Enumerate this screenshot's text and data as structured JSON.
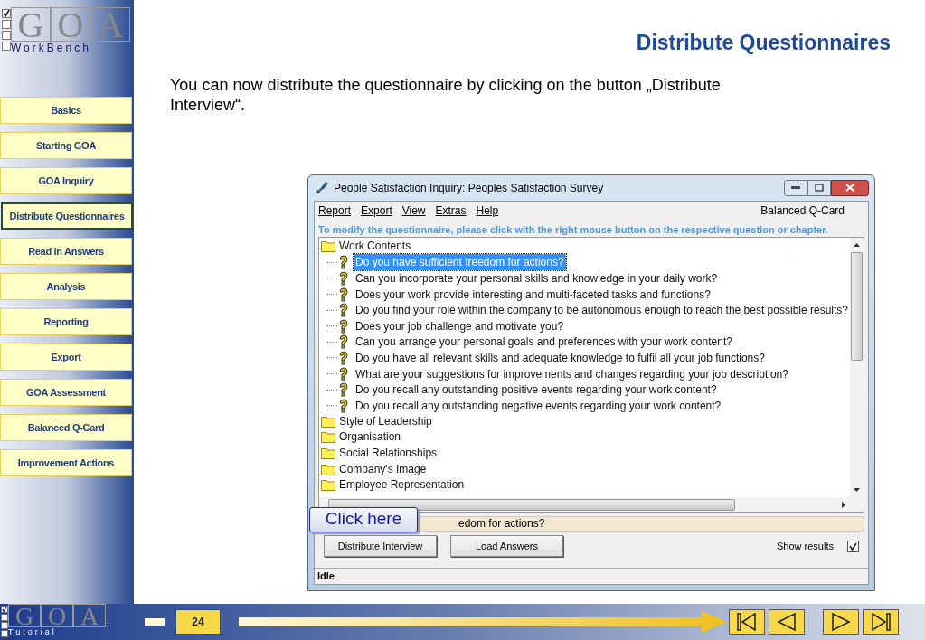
{
  "logo": {
    "letters": [
      "G",
      "O",
      "A"
    ],
    "checks": [
      true,
      false,
      false,
      false
    ],
    "subtitle": "WorkBench"
  },
  "nav": [
    {
      "label": "Basics",
      "selected": false
    },
    {
      "label": "Starting GOA",
      "selected": false
    },
    {
      "label": "GOA Inquiry",
      "selected": false
    },
    {
      "label": "Distribute Questionnaires",
      "selected": true
    },
    {
      "label": "Read in Answers",
      "selected": false
    },
    {
      "label": "Analysis",
      "selected": false
    },
    {
      "label": "Reporting",
      "selected": false
    },
    {
      "label": "Export",
      "selected": false
    },
    {
      "label": "GOA Assessment",
      "selected": false
    },
    {
      "label": "Balanced Q-Card",
      "selected": false
    },
    {
      "label": "Improvement Actions",
      "selected": false
    }
  ],
  "title": "Distribute Questionnaires",
  "intro": "You can now distribute the questionnaire by clicking on the button „Distribute Interview“.",
  "window": {
    "title": "People Satisfaction Inquiry: Peoples Satisfaction Survey",
    "menu": [
      "Report",
      "Export",
      "View",
      "Extras",
      "Help"
    ],
    "menu_right": "Balanced Q-Card",
    "hint": "To modify the questionnaire, please click with the right mouse button on the respective question or chapter.",
    "tree": [
      {
        "label": "Work Contents",
        "children": [
          {
            "label": "Do you have sufficient freedom for actions?",
            "selected": true
          },
          {
            "label": "Can you incorporate your personal skills and knowledge in your daily work?",
            "selected": false
          },
          {
            "label": "Does your work provide interesting and multi-faceted tasks and functions?",
            "selected": false
          },
          {
            "label": "Do you find your role within the company to be autonomous enough to reach the best possible results?",
            "selected": false
          },
          {
            "label": "Does your job challenge and motivate you?",
            "selected": false
          },
          {
            "label": "Can you arrange your personal goals and preferences with your work content?",
            "selected": false
          },
          {
            "label": "Do you have all relevant skills and adequate knowledge to fulfil all your job functions?",
            "selected": false
          },
          {
            "label": "What are your suggestions for improvements and changes regarding your job description?",
            "selected": false
          },
          {
            "label": "Do you recall any outstanding positive events regarding your work content?",
            "selected": false
          },
          {
            "label": "Do you recall any outstanding negative events regarding your work content?",
            "selected": false
          }
        ]
      },
      {
        "label": "Style of Leadership"
      },
      {
        "label": "Organisation"
      },
      {
        "label": "Social Relationships"
      },
      {
        "label": "Company's Image"
      },
      {
        "label": "Employee Representation"
      }
    ],
    "selected_text": "edom for actions?",
    "buttons": [
      "Distribute Interview",
      "Load Answers"
    ],
    "show_results": {
      "label": "Show results",
      "checked": true
    },
    "status": "Idle"
  },
  "callout": "Click here",
  "footer": {
    "logo_letters": [
      "G",
      "O",
      "A"
    ],
    "logo_checks": [
      true,
      false,
      false,
      false
    ],
    "logo_subtitle": "Tutorial",
    "page": "24"
  }
}
